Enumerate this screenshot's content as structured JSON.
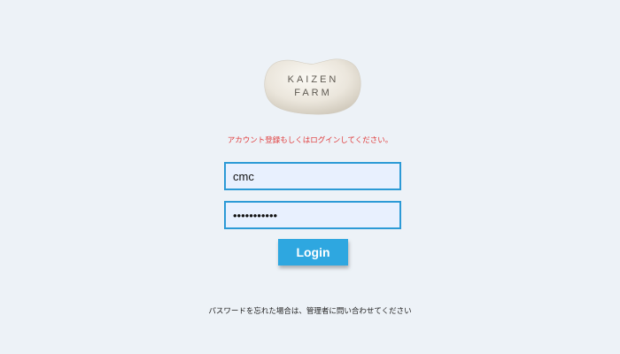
{
  "logo": {
    "line1": "KAIZEN",
    "line2": "FARM"
  },
  "error_message": "アカウント登録もしくはログインしてください。",
  "username": {
    "value": "cmc"
  },
  "password": {
    "value": "•••••••••••"
  },
  "login_button": {
    "label": "Login"
  },
  "forgot_message": "パスワードを忘れた場合は、管理者に問い合わせてください",
  "colors": {
    "background": "#edf2f7",
    "accent": "#2ea7e0",
    "field_border": "#2c9ad6",
    "field_background": "#e8f0fe",
    "error_text": "#e03a3a"
  }
}
